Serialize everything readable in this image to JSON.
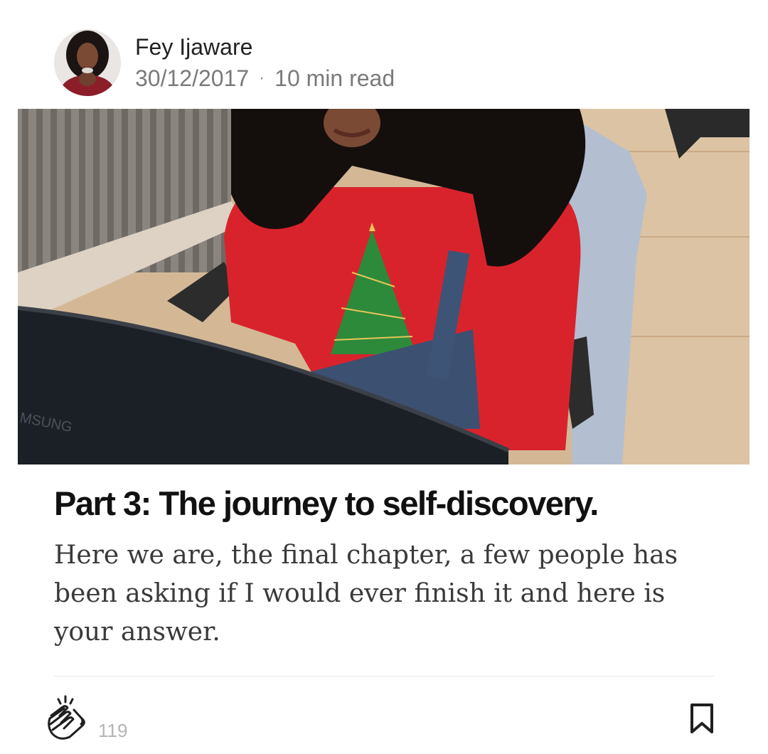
{
  "author": {
    "name": "Fey Ijaware",
    "date": "30/12/2017",
    "separator": "·",
    "read_time": "10 min read"
  },
  "post": {
    "title": "Part 3: The journey to self-discovery.",
    "subtitle": "Here we are, the final chapter, a few people has been asking if I would ever finish it and here is your answer.",
    "hero_monitor_brand": "MSUNG"
  },
  "footer": {
    "clap_icon": "clap-icon",
    "clap_count": "119",
    "bookmark_icon": "bookmark-icon"
  },
  "colors": {
    "title": "#111111",
    "meta": "#7a7a7a",
    "clap_count": "#b4b4b4"
  }
}
